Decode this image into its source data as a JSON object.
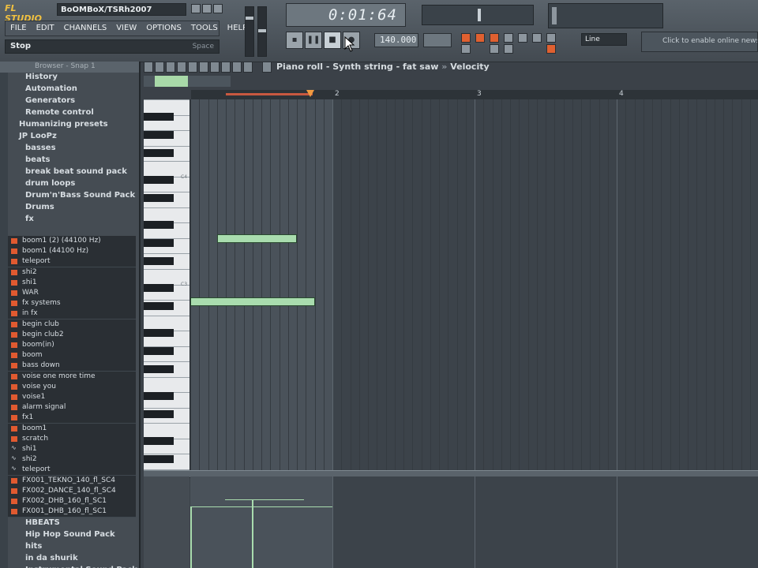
{
  "app": {
    "logo": "FL STUDIO",
    "project_title": "BoOMBoX/TSRh2007"
  },
  "menu": [
    "FILE",
    "EDIT",
    "CHANNELS",
    "VIEW",
    "OPTIONS",
    "TOOLS",
    "HELP"
  ],
  "hint_bar": {
    "left": "Stop",
    "right": "Space"
  },
  "transport": {
    "time": "0:01:64",
    "tempo": "140.000",
    "snap": "Line"
  },
  "news": "Click to enable online news",
  "browser": {
    "header": "Browser - Snap 1",
    "folders_top": [
      {
        "label": "History",
        "sub": true
      },
      {
        "label": "Automation",
        "sub": true
      },
      {
        "label": "Generators",
        "sub": true
      },
      {
        "label": "Remote control",
        "sub": true
      },
      {
        "label": "Humanizing presets",
        "sub": false
      },
      {
        "label": "JP LooPz",
        "sub": false
      },
      {
        "label": "basses",
        "sub": true
      },
      {
        "label": "beats",
        "sub": true
      },
      {
        "label": "break beat sound pack",
        "sub": true
      },
      {
        "label": "drum loops",
        "sub": true
      },
      {
        "label": "Drum'n'Bass Sound Pack",
        "sub": true
      },
      {
        "label": "Drums",
        "sub": true
      },
      {
        "label": "fx",
        "sub": true
      }
    ],
    "files": [
      {
        "label": "boom1 (2) (44100 Hz)",
        "icon": "file"
      },
      {
        "label": "boom1 (44100 Hz)",
        "icon": "file"
      },
      {
        "label": "teleport",
        "icon": "file"
      },
      {
        "label": "shi2",
        "icon": "file"
      },
      {
        "label": "shi1",
        "icon": "file"
      },
      {
        "label": "WAR",
        "icon": "file"
      },
      {
        "label": "fx systems",
        "icon": "file"
      },
      {
        "label": "in fx",
        "icon": "file"
      },
      {
        "label": "begin club",
        "icon": "file"
      },
      {
        "label": "begin club2",
        "icon": "file"
      },
      {
        "label": "boom(in)",
        "icon": "file"
      },
      {
        "label": "boom",
        "icon": "file"
      },
      {
        "label": "bass down",
        "icon": "file"
      },
      {
        "label": "voise one more time",
        "icon": "file"
      },
      {
        "label": "voise you",
        "icon": "file"
      },
      {
        "label": "voise1",
        "icon": "file"
      },
      {
        "label": "alarm signal",
        "icon": "file"
      },
      {
        "label": "fx1",
        "icon": "file"
      },
      {
        "label": "boom1",
        "icon": "file"
      },
      {
        "label": "scratch",
        "icon": "file"
      },
      {
        "label": "shi1",
        "icon": "wave"
      },
      {
        "label": "shi2",
        "icon": "wave"
      },
      {
        "label": "teleport",
        "icon": "wave"
      },
      {
        "label": "FX001_TEKNO_140_fl_SC4",
        "icon": "file"
      },
      {
        "label": "FX002_DANCE_140_fl_SC4",
        "icon": "file"
      },
      {
        "label": "FX002_DHB_160_fl_SC1",
        "icon": "file"
      },
      {
        "label": "FX001_DHB_160_fl_SC1",
        "icon": "file"
      }
    ],
    "folders_bottom": [
      "HBEATS",
      "Hip Hop Sound Pack",
      "hits",
      "in da shurik",
      "Instrumental Sound Pack"
    ]
  },
  "piano_roll": {
    "title": "Piano roll - Synth string - fat saw",
    "separator": "»",
    "view": "Velocity",
    "bar_numbers": [
      "2",
      "3",
      "4"
    ],
    "octave_labels": [
      "C4",
      "C3"
    ],
    "notes": [
      {
        "start_step": 3,
        "length_steps": 9,
        "row": 15
      },
      {
        "start_step": 0,
        "length_steps": 14,
        "row": 22
      }
    ],
    "velocity": [
      {
        "step": 3,
        "level": 0.95
      },
      {
        "step": 0,
        "level": 0.85
      }
    ]
  }
}
